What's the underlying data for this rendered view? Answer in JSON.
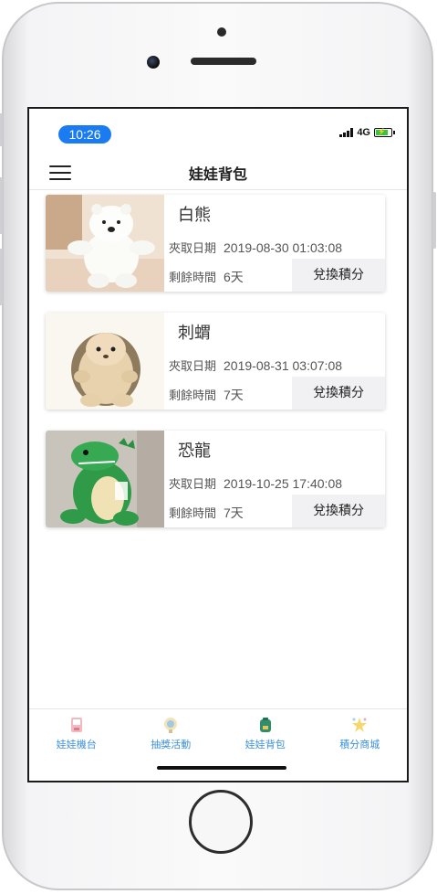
{
  "status_bar": {
    "time": "10:26",
    "network": "4G"
  },
  "navbar": {
    "title": "娃娃背包"
  },
  "cards": [
    {
      "name": "白熊",
      "image_icon": "white-bear-plush-image",
      "catch_date_label": "夾取日期",
      "catch_date": "2019-08-30 01:03:08",
      "remaining_label": "剩餘時間",
      "remaining": "6天",
      "exchange_label": "兌換積分"
    },
    {
      "name": "刺蝟",
      "image_icon": "hedgehog-plush-image",
      "catch_date_label": "夾取日期",
      "catch_date": "2019-08-31 03:07:08",
      "remaining_label": "剩餘時間",
      "remaining": "7天",
      "exchange_label": "兌換積分"
    },
    {
      "name": "恐龍",
      "image_icon": "dinosaur-plush-image",
      "catch_date_label": "夾取日期",
      "catch_date": "2019-10-25 17:40:08",
      "remaining_label": "剩餘時間",
      "remaining": "7天",
      "exchange_label": "兌換積分"
    }
  ],
  "tabbar": {
    "items": [
      {
        "label": "娃娃機台",
        "icon": "claw-machine-icon"
      },
      {
        "label": "抽獎活動",
        "icon": "lottery-icon"
      },
      {
        "label": "娃娃背包",
        "icon": "backpack-icon"
      },
      {
        "label": "積分商城",
        "icon": "points-mall-icon"
      }
    ],
    "label_color": "#3b8fd9"
  },
  "colors": {
    "status_time_bg": "#1a7cf0",
    "exchange_bg": "#f1f1f3"
  }
}
